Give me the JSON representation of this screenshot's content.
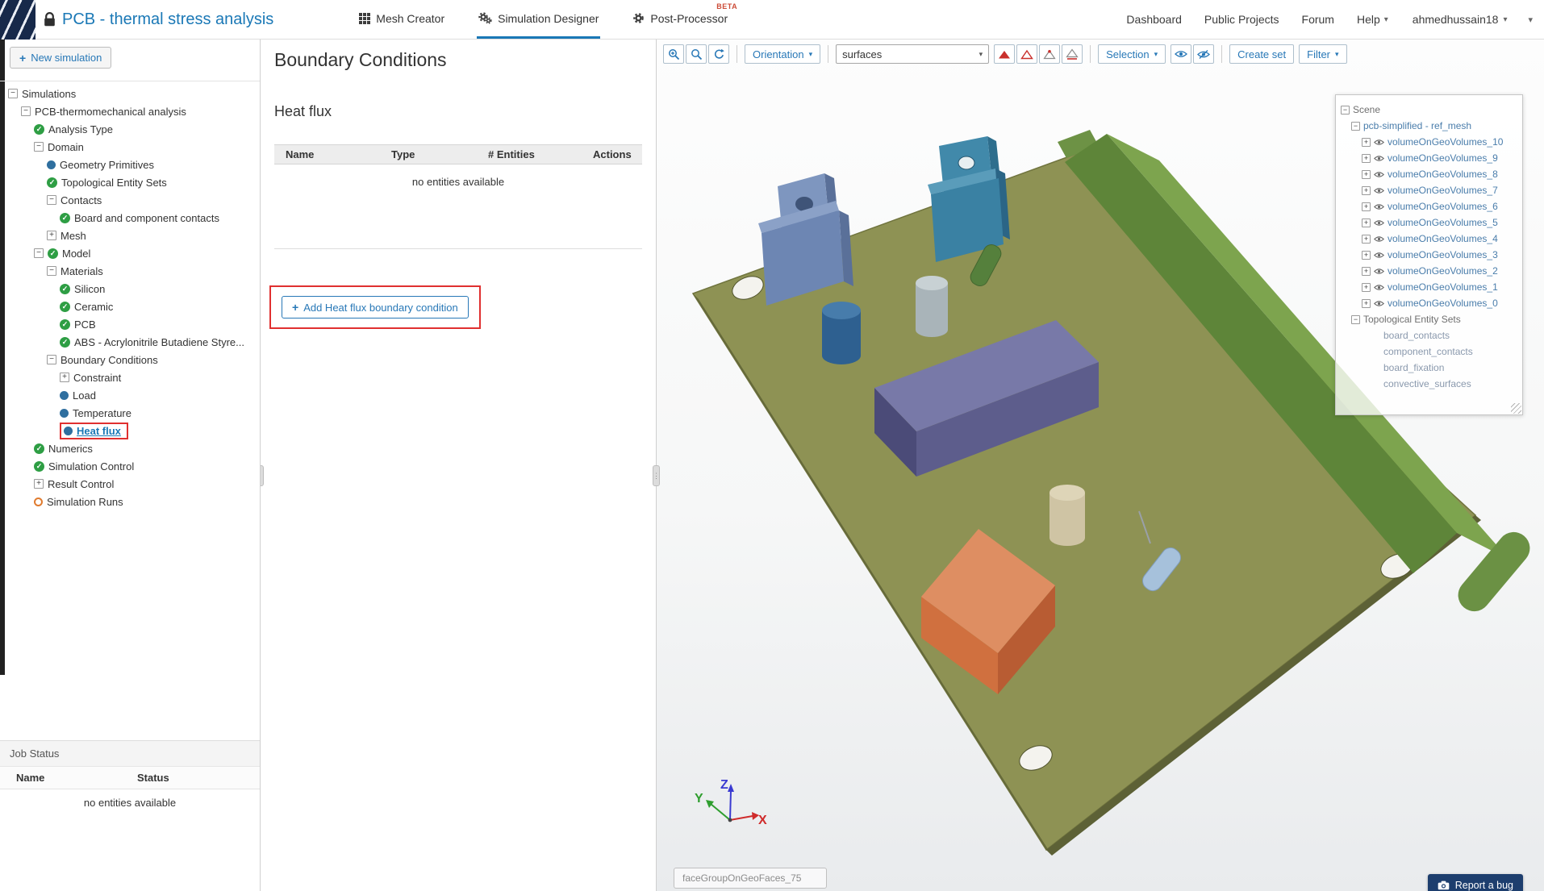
{
  "navbar": {
    "title": "PCB - thermal stress analysis",
    "tabs": [
      {
        "label": "Mesh Creator",
        "icon": "grid-icon",
        "active": false,
        "badge": ""
      },
      {
        "label": "Simulation Designer",
        "icon": "gears-icon",
        "active": true,
        "badge": ""
      },
      {
        "label": "Post-Processor",
        "icon": "gear-icon",
        "active": false,
        "badge": "BETA"
      }
    ],
    "links": [
      "Dashboard",
      "Public Projects",
      "Forum"
    ],
    "help_label": "Help",
    "username": "ahmedhussain18"
  },
  "sidebar": {
    "new_simulation_label": "New simulation",
    "tree": [
      {
        "label": "Simulations",
        "level": 0,
        "expander": "minus"
      },
      {
        "label": "PCB-thermomechanical analysis",
        "level": 1,
        "expander": "minus"
      },
      {
        "label": "Analysis Type",
        "level": 2,
        "icon": "check"
      },
      {
        "label": "Domain",
        "level": 2,
        "expander": "minus"
      },
      {
        "label": "Geometry Primitives",
        "level": 3,
        "icon": "dot"
      },
      {
        "label": "Topological Entity Sets",
        "level": 3,
        "icon": "check"
      },
      {
        "label": "Contacts",
        "level": 3,
        "expander": "minus"
      },
      {
        "label": "Board and component contacts",
        "level": 4,
        "icon": "check"
      },
      {
        "label": "Mesh",
        "level": 3,
        "expander": "plus"
      },
      {
        "label": "Model",
        "level": 2,
        "expander": "minus",
        "icon": "check"
      },
      {
        "label": "Materials",
        "level": 3,
        "expander": "minus"
      },
      {
        "label": "Silicon",
        "level": 4,
        "icon": "check"
      },
      {
        "label": "Ceramic",
        "level": 4,
        "icon": "check"
      },
      {
        "label": "PCB",
        "level": 4,
        "icon": "check"
      },
      {
        "label": "ABS - Acrylonitrile Butadiene Styre...",
        "level": 4,
        "icon": "check"
      },
      {
        "label": "Boundary Conditions",
        "level": 3,
        "expander": "minus"
      },
      {
        "label": "Constraint",
        "level": 4,
        "expander": "plus"
      },
      {
        "label": "Load",
        "level": 4,
        "icon": "dot"
      },
      {
        "label": "Temperature",
        "level": 4,
        "icon": "dot"
      },
      {
        "label": "Heat flux",
        "level": 4,
        "icon": "dot",
        "selected": true
      },
      {
        "label": "Numerics",
        "level": 2,
        "icon": "check"
      },
      {
        "label": "Simulation Control",
        "level": 2,
        "icon": "check"
      },
      {
        "label": "Result Control",
        "level": 2,
        "expander": "plus"
      },
      {
        "label": "Simulation Runs",
        "level": 2,
        "icon": "circle"
      }
    ],
    "job_status": {
      "title": "Job Status",
      "columns": [
        "Name",
        "Status"
      ],
      "empty": "no entities available"
    }
  },
  "panel": {
    "title": "Boundary Conditions",
    "section": "Heat flux",
    "table": {
      "columns": [
        "Name",
        "Type",
        "# Entities",
        "Actions"
      ],
      "empty": "no entities available"
    },
    "add_button_label": "Add Heat flux boundary condition"
  },
  "viewport": {
    "toolbar": {
      "orientation_label": "Orientation",
      "surfaces_value": "surfaces",
      "selection_label": "Selection",
      "create_set_label": "Create set",
      "filter_label": "Filter"
    },
    "scene_tree": [
      {
        "label": "Scene",
        "level": 0,
        "expander": "minus",
        "type": "plain"
      },
      {
        "label": "pcb-simplified - ref_mesh",
        "level": 1,
        "expander": "minus",
        "type": "link"
      },
      {
        "label": "volumeOnGeoVolumes_10",
        "level": 2,
        "expander": "plus",
        "eye": true,
        "type": "link"
      },
      {
        "label": "volumeOnGeoVolumes_9",
        "level": 2,
        "expander": "plus",
        "eye": true,
        "type": "link"
      },
      {
        "label": "volumeOnGeoVolumes_8",
        "level": 2,
        "expander": "plus",
        "eye": true,
        "type": "link"
      },
      {
        "label": "volumeOnGeoVolumes_7",
        "level": 2,
        "expander": "plus",
        "eye": true,
        "type": "link"
      },
      {
        "label": "volumeOnGeoVolumes_6",
        "level": 2,
        "expander": "plus",
        "eye": true,
        "type": "link"
      },
      {
        "label": "volumeOnGeoVolumes_5",
        "level": 2,
        "expander": "plus",
        "eye": true,
        "type": "link"
      },
      {
        "label": "volumeOnGeoVolumes_4",
        "level": 2,
        "expander": "plus",
        "eye": true,
        "type": "link"
      },
      {
        "label": "volumeOnGeoVolumes_3",
        "level": 2,
        "expander": "plus",
        "eye": true,
        "type": "link"
      },
      {
        "label": "volumeOnGeoVolumes_2",
        "level": 2,
        "expander": "plus",
        "eye": true,
        "type": "link"
      },
      {
        "label": "volumeOnGeoVolumes_1",
        "level": 2,
        "expander": "plus",
        "eye": true,
        "type": "link"
      },
      {
        "label": "volumeOnGeoVolumes_0",
        "level": 2,
        "expander": "plus",
        "eye": true,
        "type": "link"
      },
      {
        "label": "Topological Entity Sets",
        "level": 1,
        "expander": "minus",
        "type": "plain"
      },
      {
        "label": "board_contacts",
        "level": 2,
        "type": "muted",
        "pad": true
      },
      {
        "label": "component_contacts",
        "level": 2,
        "type": "muted",
        "pad": true
      },
      {
        "label": "board_fixation",
        "level": 2,
        "type": "muted",
        "pad": true
      },
      {
        "label": "convective_surfaces",
        "level": 2,
        "type": "muted",
        "pad": true
      }
    ],
    "axis": {
      "x": "X",
      "y": "Y",
      "z": "Z"
    },
    "face_group_label": "faceGroupOnGeoFaces_75",
    "report_bug_label": "Report a bug"
  },
  "colors": {
    "accent_blue": "#1a78b6",
    "toolbar_blue": "#2878b7",
    "highlight_red": "#e03030",
    "check_green": "#2e9e44",
    "dot_blue": "#2f6f9f",
    "pending_orange": "#e07b2f",
    "board_olive": "#8e9254",
    "report_bug_navy": "#1d3e6e"
  }
}
